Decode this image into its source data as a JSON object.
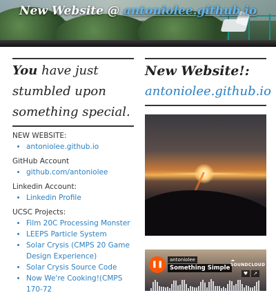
{
  "header": {
    "title_prefix": "New Website @ ",
    "title_link": "antoniolee.github.io"
  },
  "left": {
    "heading": {
      "emph": "You",
      "rest": " have just stumbled upon something special."
    },
    "sections": [
      {
        "label": "NEW WEBSITE:",
        "links": [
          "antoniolee.github.io"
        ]
      },
      {
        "label": "GitHub Account",
        "links": [
          "github.com/antoniolee"
        ]
      },
      {
        "label": "Linkedin Account:",
        "links": [
          "Linkedin Profile"
        ]
      },
      {
        "label": "UCSC Projects:",
        "links": [
          "Film 20C Processing Monster",
          "LEEPS Particle System",
          "Solar Crysis (CMPS 20 Game Design Experience)",
          "Solar Crysis Source Code",
          "Now We're Cooking!(CMPS 170-72"
        ]
      }
    ]
  },
  "right": {
    "title": "New Website!:",
    "link": "antoniolee.github.io"
  },
  "player": {
    "artist": "antoniolee",
    "track": "Something Simple",
    "brand": "SOUNDCLOUD",
    "play_icon": "pause-icon",
    "accent": "#ff5500"
  },
  "colors": {
    "link": "#2a7fc1",
    "text": "#333333",
    "rule": "#333333"
  }
}
